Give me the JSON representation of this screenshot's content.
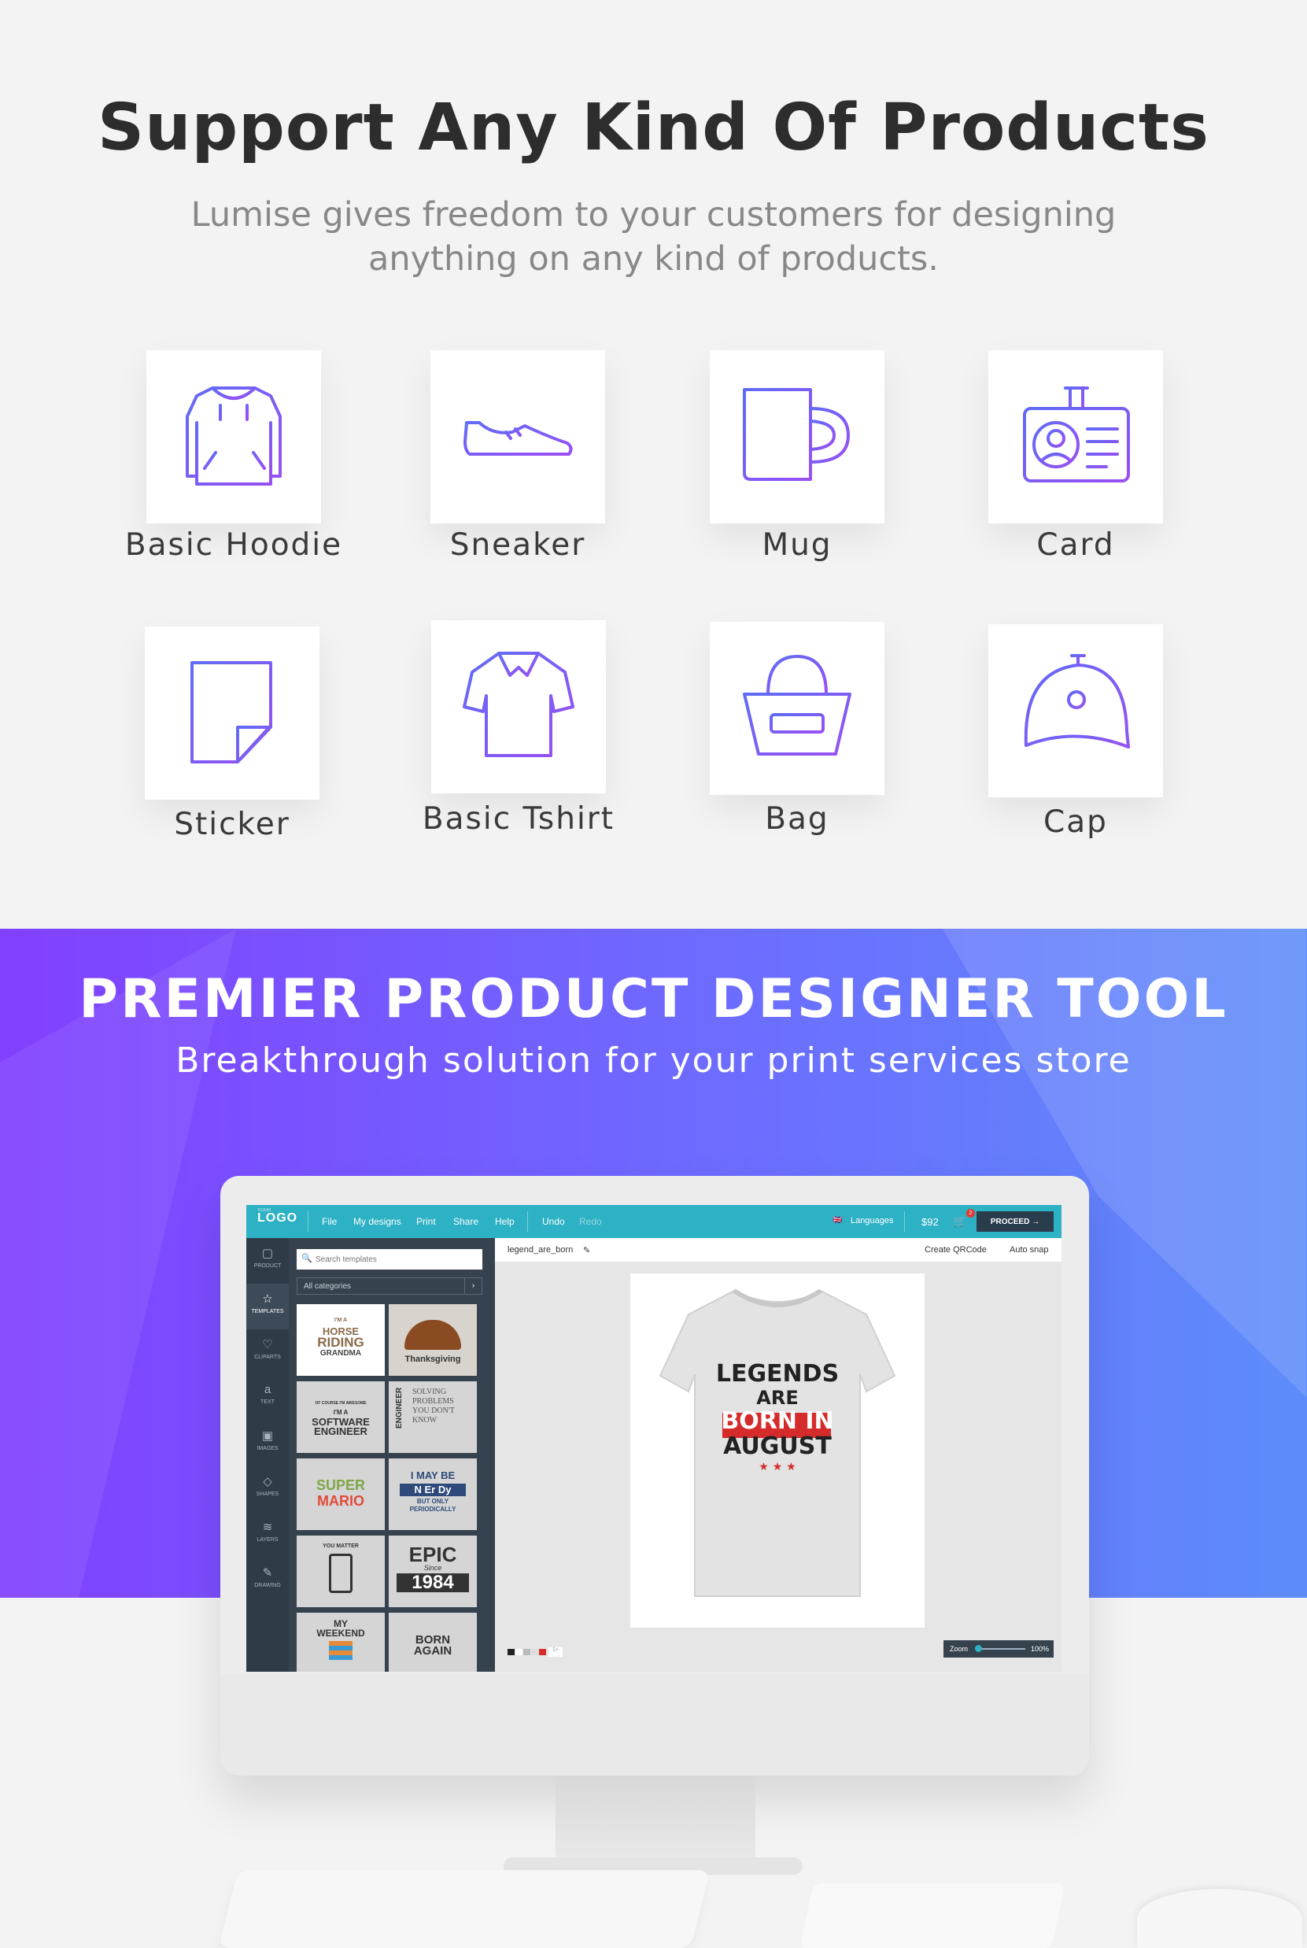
{
  "section1": {
    "title": "Support Any Kind Of Products",
    "subtitle_lines": [
      "Lumise gives freedom to your customers for designing",
      "anything on any kind of products."
    ],
    "products": [
      {
        "label": "Basic Hoodie",
        "icon": "hoodie-icon"
      },
      {
        "label": "Sneaker",
        "icon": "sneaker-icon"
      },
      {
        "label": "Mug",
        "icon": "mug-icon"
      },
      {
        "label": "Card",
        "icon": "id-card-icon"
      },
      {
        "label": "Sticker",
        "icon": "sticker-icon"
      },
      {
        "label": "Basic Tshirt",
        "icon": "polo-shirt-icon"
      },
      {
        "label": "Bag",
        "icon": "basket-bag-icon"
      },
      {
        "label": "Cap",
        "icon": "cap-icon"
      }
    ],
    "icon_gradient": [
      "#5f6cf6",
      "#9a4ff3"
    ]
  },
  "section2": {
    "title": "PREMIER PRODUCT DESIGNER TOOL",
    "subtitle": "Breakthrough solution for your print services store",
    "gradient": [
      "#8140ff",
      "#5d8cfa"
    ]
  },
  "app": {
    "logo_small": "YOUR",
    "logo": "LOGO",
    "menu": [
      "File",
      "My designs",
      "Print",
      "Share",
      "Help"
    ],
    "undo": "Undo",
    "redo": "Redo",
    "language": "Languages",
    "price": "$92",
    "cart_count": "2",
    "proceed": "PROCEED",
    "sidebar": [
      "PRODUCT",
      "TEMPLATES",
      "CLIPARTS",
      "TEXT",
      "IMAGES",
      "SHAPES",
      "LAYERS",
      "DRAWING"
    ],
    "search_placeholder": "Search templates",
    "category": "All categories",
    "filename": "legend_are_born",
    "create_qr": "Create QRCode",
    "auto_snap": "Auto snap",
    "zoom_label": "Zoom",
    "zoom_value": "100%",
    "templates": [
      {
        "lines": [
          "I'M A",
          "HORSE",
          "RIDING",
          "GRANDMA"
        ]
      },
      {
        "lines": [
          "Thanksgiving"
        ]
      },
      {
        "lines": [
          "OF COURSE I'M AWESOME",
          "I'M A",
          "SOFTWARE",
          "ENGINEER"
        ]
      },
      {
        "lines": [
          "ENGINEER",
          "SOLVING",
          "PROBLEMS",
          "YOU DON'T KNOW"
        ]
      },
      {
        "lines": [
          "SUPER",
          "MARIO"
        ]
      },
      {
        "lines": [
          "I MAY BE",
          "N Er Dy",
          "BUT ONLY",
          "PERIODICALLY"
        ]
      },
      {
        "lines": [
          "YOU MATTER"
        ]
      },
      {
        "lines": [
          "EPIC",
          "Since",
          "1984"
        ]
      },
      {
        "lines": [
          "MY",
          "WEEKEND"
        ]
      },
      {
        "lines": [
          "BORN",
          "AGAIN"
        ]
      }
    ],
    "shirt_text": [
      "LEGENDS",
      "ARE",
      "BORN IN",
      "AUGUST"
    ],
    "shirt_stars": "★ ★ ★",
    "page_count": "1+"
  }
}
